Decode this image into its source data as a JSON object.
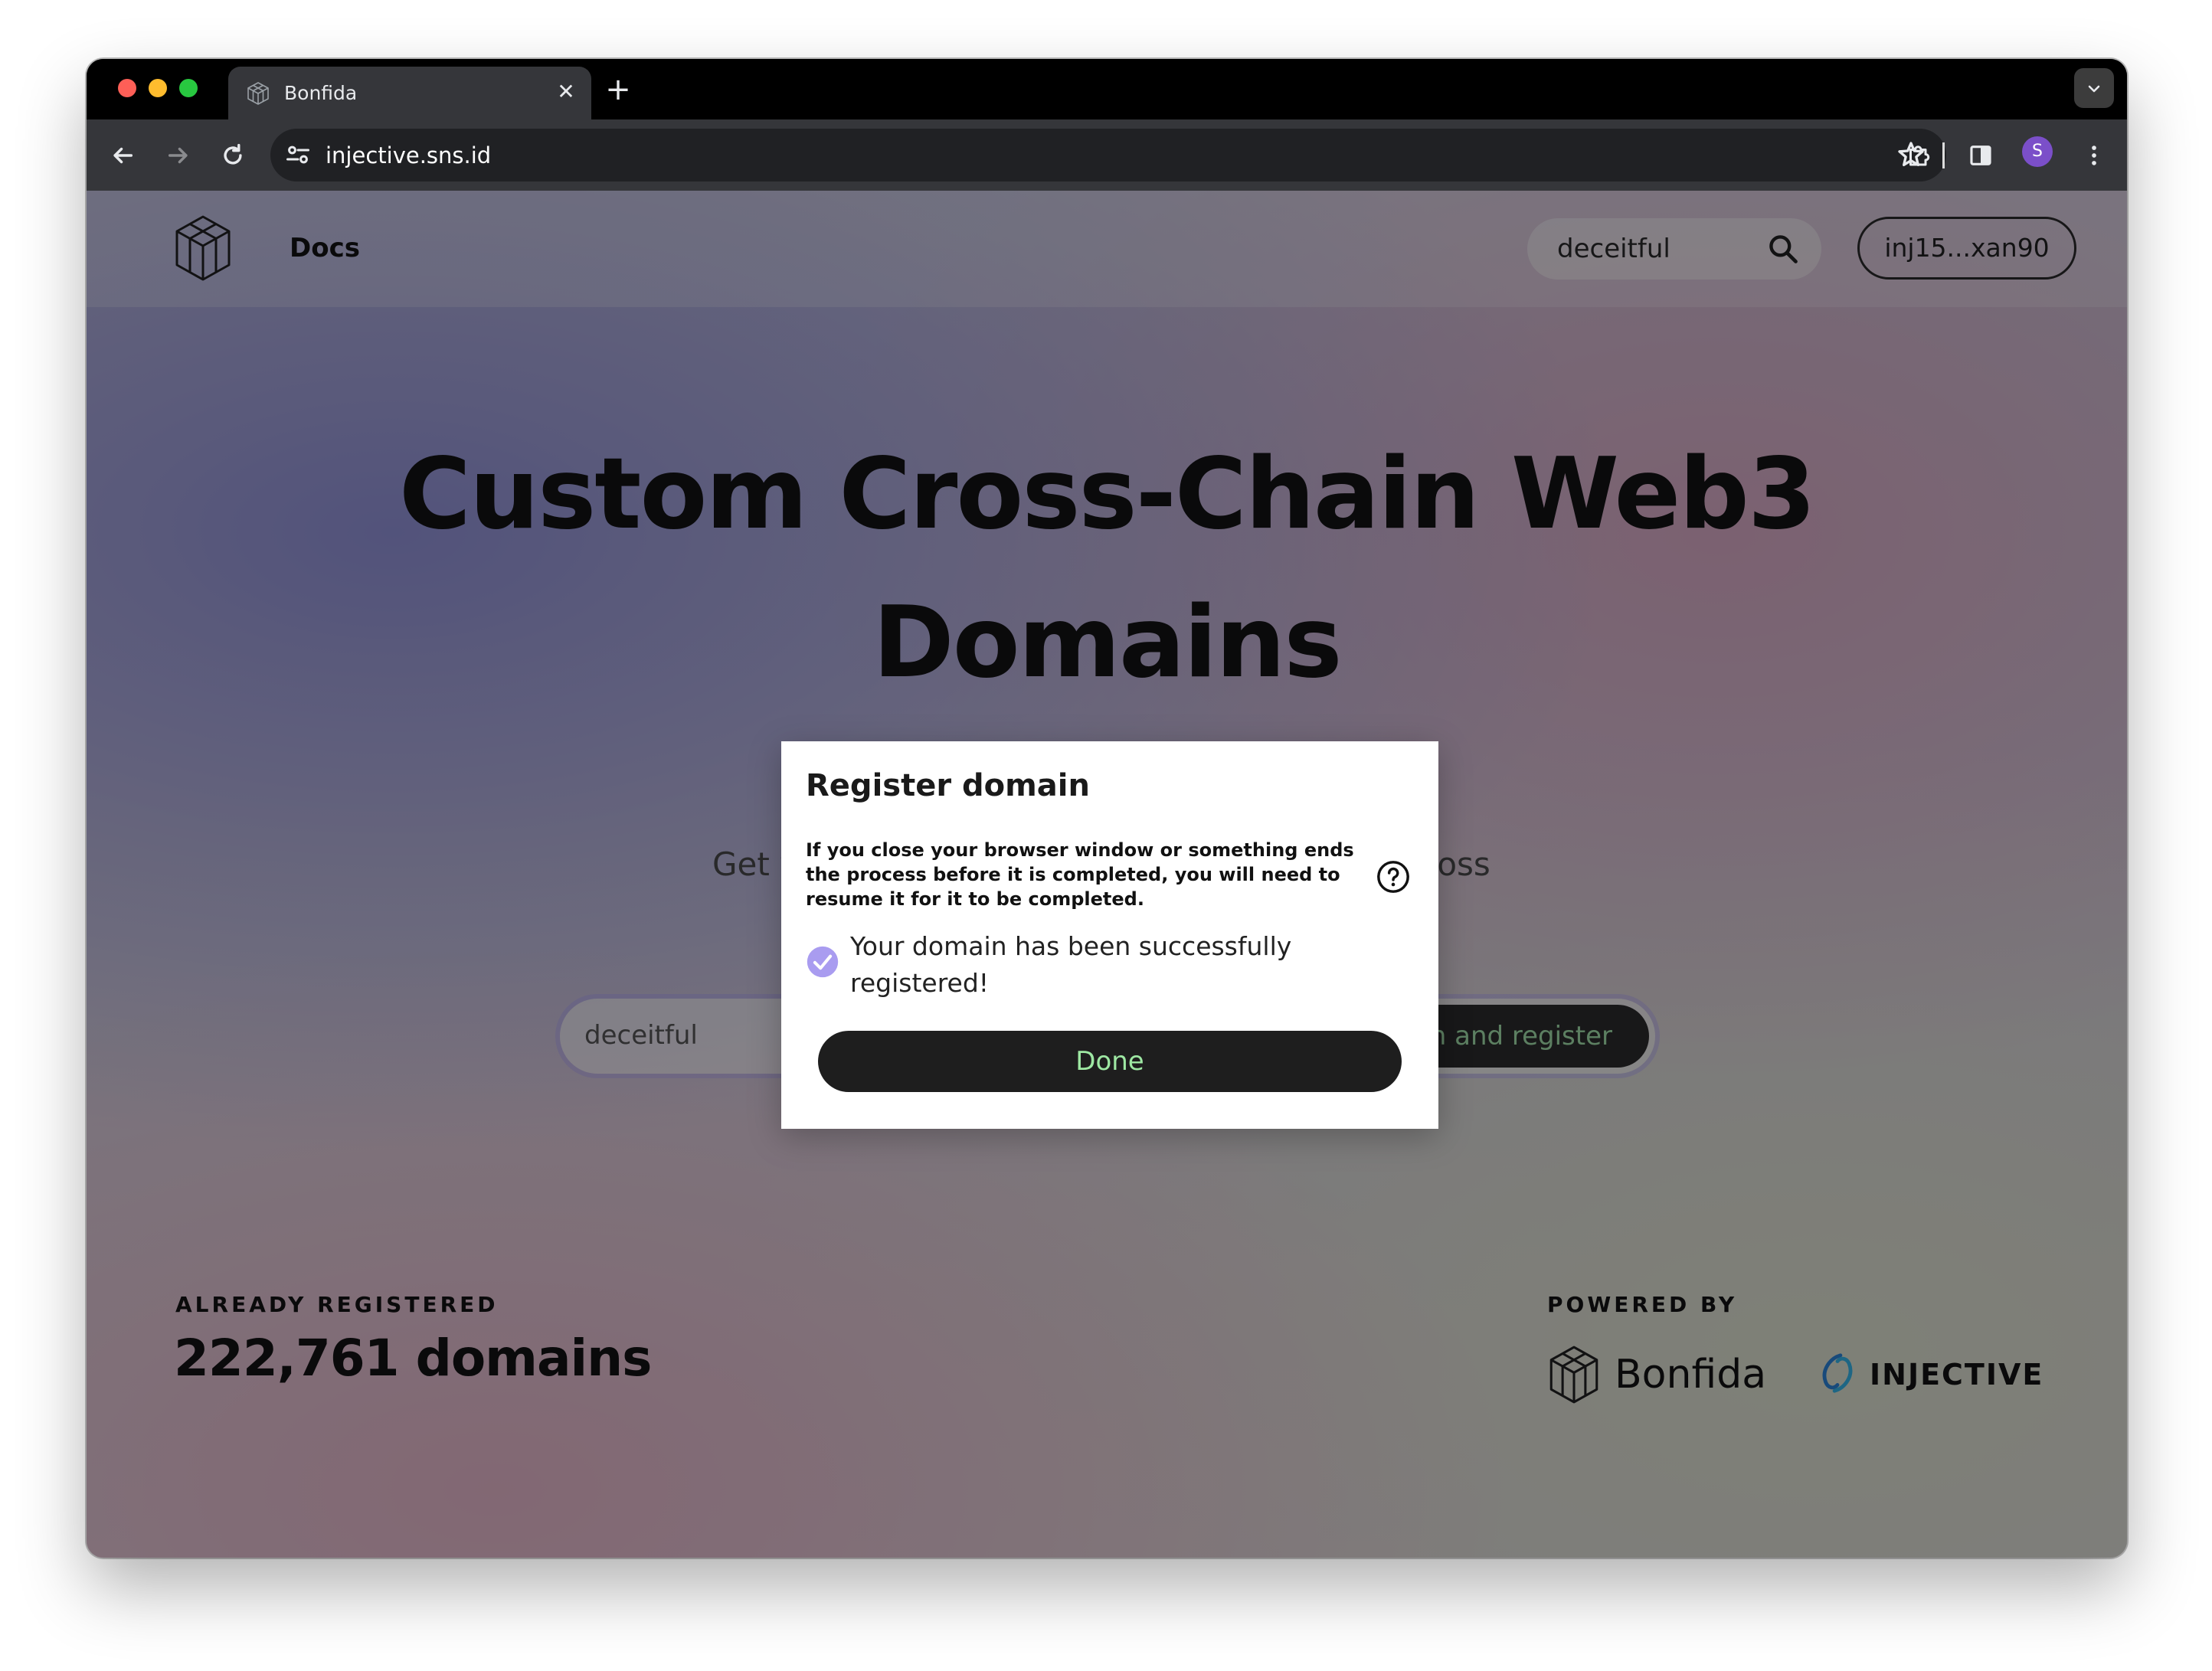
{
  "browser": {
    "tab_title": "Bonfida",
    "tab_close": "✕",
    "new_tab": "+",
    "url": "injective.sns.id",
    "profile_initial": "S"
  },
  "header": {
    "docs_label": "Docs",
    "search_value": "deceitful",
    "wallet_label": "inj15...xan90"
  },
  "hero": {
    "title": "Custom Cross-Chain Web3 Domains",
    "subtitle_left_fragment": "Get y",
    "subtitle_right_fragment": "ross",
    "search_value": "deceitful",
    "search_button_fragment": "h and register"
  },
  "stats": {
    "label": "ALREADY REGISTERED",
    "value": "222,761 domains"
  },
  "powered": {
    "label": "POWERED BY",
    "bonfida": "Bonfida",
    "injective": "INJECTIVE"
  },
  "modal": {
    "title": "Register domain",
    "warning": "If you close your browser window or something ends the process before it is completed, you will need to resume it for it to be completed.",
    "success": "Your domain has been successfully registered!",
    "done_label": "Done"
  },
  "colors": {
    "accent_green": "#9ee8a3",
    "check_purple": "#a99cf0",
    "dark_button": "#1e1e1e"
  }
}
